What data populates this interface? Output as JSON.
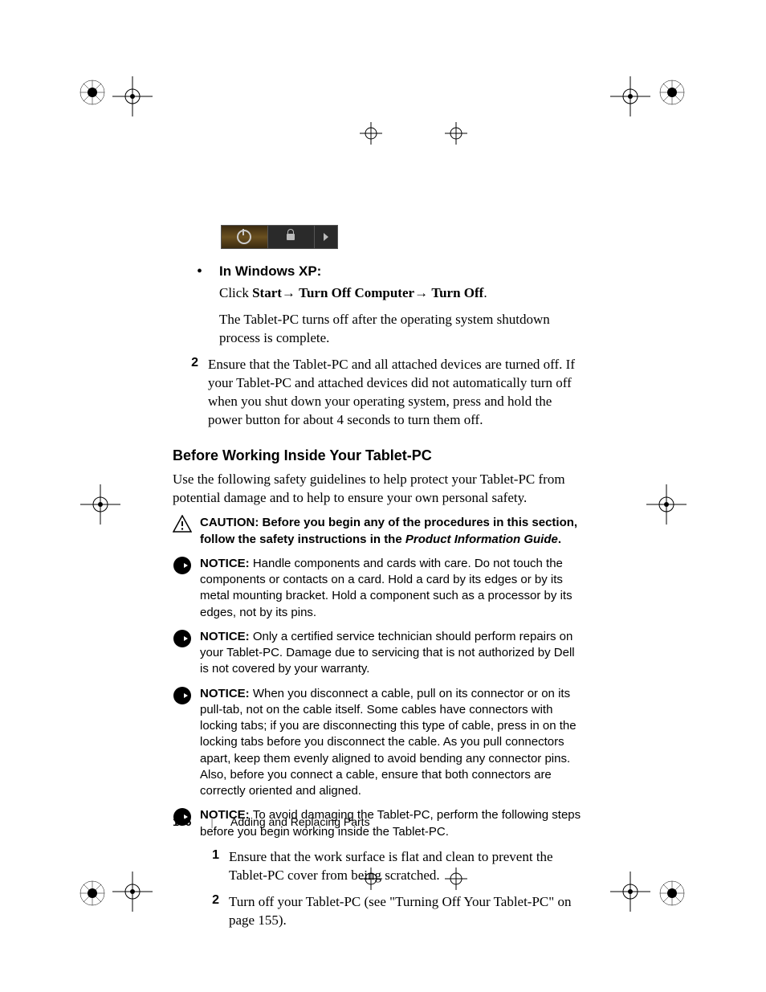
{
  "image": {
    "power_label": "power",
    "lock_label": "lock",
    "arrow_label": "arrow"
  },
  "bullet1": "In Windows XP:",
  "click_line": {
    "pre": "Click ",
    "b1": "Start",
    "arrow1": "→ ",
    "b2": "Turn Off Computer",
    "arrow2": "→ ",
    "b3": "Turn Off",
    "post": "."
  },
  "after_click": "The Tablet-PC turns off after the operating system shutdown process is complete.",
  "step2_num": "2",
  "step2": "Ensure that the Tablet-PC and all attached devices are turned off. If your Tablet-PC and attached devices did not automatically turn off when you shut down your operating system, press and hold the power button for about 4 seconds to turn them off.",
  "section_head": "Before Working Inside Your Tablet-PC",
  "intro": "Use the following safety guidelines to help protect your Tablet-PC from potential damage and to help to ensure your own personal safety.",
  "caution": {
    "label": "CAUTION: ",
    "text1": "Before you begin any of the procedures in this section, follow the safety instructions in the ",
    "ital": "Product Information Guide",
    "text2": "."
  },
  "notice1": {
    "label": "NOTICE: ",
    "text": "Handle components and cards with care. Do not touch the components or contacts on a card. Hold a card by its edges or by its metal mounting bracket. Hold a component such as a processor by its edges, not by its pins."
  },
  "notice2": {
    "label": "NOTICE: ",
    "text": "Only a certified service technician should perform repairs on your Tablet-PC. Damage due to servicing that is not authorized by Dell is not covered by your warranty."
  },
  "notice3": {
    "label": "NOTICE: ",
    "text": "When you disconnect a cable, pull on its connector or on its pull-tab, not on the cable itself. Some cables have connectors with locking tabs; if you are disconnecting this type of cable, press in on the locking tabs before you disconnect the cable. As you pull connectors apart, keep them evenly aligned to avoid bending any connector pins. Also, before you connect a cable, ensure that both connectors are correctly oriented and aligned."
  },
  "notice4": {
    "label": "NOTICE: ",
    "text": "To avoid damaging the Tablet-PC, perform the following steps before you begin working inside the Tablet-PC."
  },
  "sub1_num": "1",
  "sub1": "Ensure that the work surface is flat and clean to prevent the Tablet-PC cover from being scratched.",
  "sub2_num": "2",
  "sub2": "Turn off your Tablet-PC (see \"Turning Off Your Tablet-PC\" on page 155).",
  "footer": {
    "page": "156",
    "divider": "|",
    "chapter": "Adding and Replacing Parts"
  }
}
